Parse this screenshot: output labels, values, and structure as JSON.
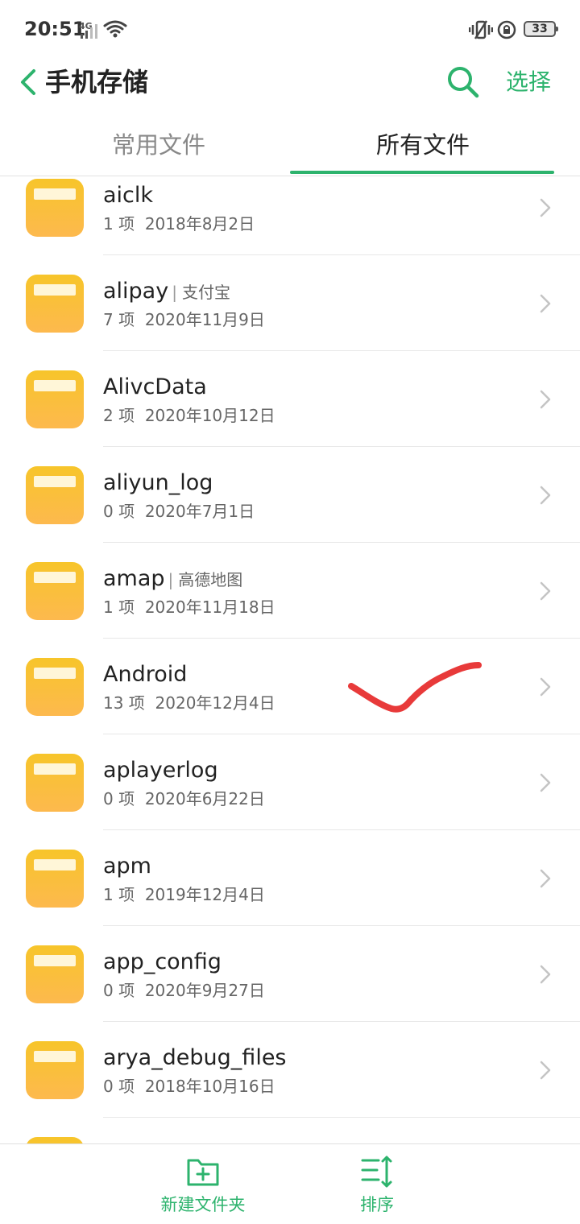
{
  "status_bar": {
    "time": "20:51",
    "network": "4G",
    "battery": "33"
  },
  "header": {
    "title": "手机存储",
    "select_label": "选择"
  },
  "tabs": [
    {
      "label": "常用文件",
      "active": false
    },
    {
      "label": "所有文件",
      "active": true
    }
  ],
  "files": [
    {
      "name": "aiclk",
      "alias": "",
      "count": "1 项",
      "date": "2018年8月2日"
    },
    {
      "name": "alipay",
      "alias": "支付宝",
      "count": "7 项",
      "date": "2020年11月9日"
    },
    {
      "name": "AlivcData",
      "alias": "",
      "count": "2 项",
      "date": "2020年10月12日"
    },
    {
      "name": "aliyun_log",
      "alias": "",
      "count": "0 项",
      "date": "2020年7月1日"
    },
    {
      "name": "amap",
      "alias": "高德地图",
      "count": "1 项",
      "date": "2020年11月18日"
    },
    {
      "name": "Android",
      "alias": "",
      "count": "13 项",
      "date": "2020年12月4日"
    },
    {
      "name": "aplayerlog",
      "alias": "",
      "count": "0 项",
      "date": "2020年6月22日"
    },
    {
      "name": "apm",
      "alias": "",
      "count": "1 项",
      "date": "2019年12月4日"
    },
    {
      "name": "app_config",
      "alias": "",
      "count": "0 项",
      "date": "2020年9月27日"
    },
    {
      "name": "arya_debug_files",
      "alias": "",
      "count": "0 项",
      "date": "2018年10月16日"
    },
    {
      "name": "",
      "alias": "",
      "count": "",
      "date": ""
    }
  ],
  "bottom_bar": {
    "new_folder_label": "新建文件夹",
    "sort_label": "排序"
  },
  "colors": {
    "accent": "#2db36d",
    "folder_top": "#f7c52a",
    "folder_bottom": "#fdb94e",
    "annotation": "#e83a3a"
  }
}
